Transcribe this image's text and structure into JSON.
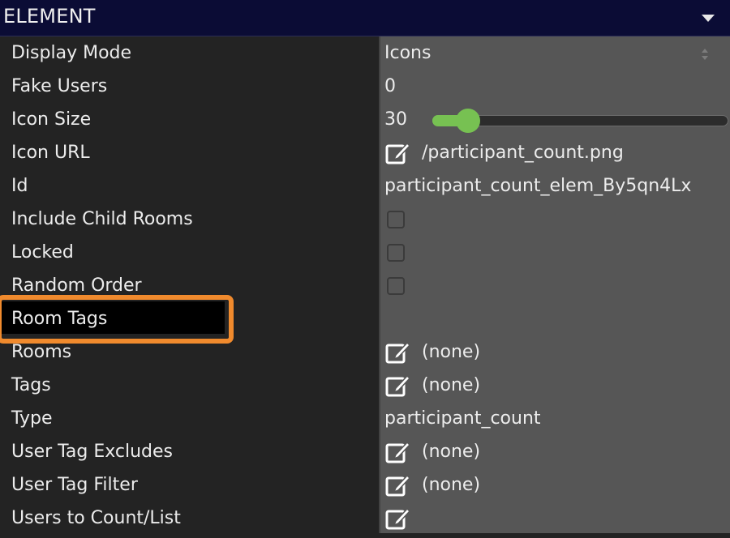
{
  "header": {
    "title": "ELEMENT",
    "collapse_icon": "caret-down-icon"
  },
  "properties": [
    {
      "label": "Display Mode",
      "value": "Icons",
      "kind": "select"
    },
    {
      "label": "Fake Users",
      "value": "0",
      "kind": "text"
    },
    {
      "label": "Icon Size",
      "value": "30",
      "kind": "slider",
      "slider_fraction": 0.08
    },
    {
      "label": "Icon URL",
      "value": "/participant_count.png",
      "kind": "edit"
    },
    {
      "label": "Id",
      "value": "participant_count_elem_By5qn4Lx",
      "kind": "text"
    },
    {
      "label": "Include Child Rooms",
      "value": "",
      "kind": "checkbox",
      "checked": false
    },
    {
      "label": "Locked",
      "value": "",
      "kind": "checkbox",
      "checked": false
    },
    {
      "label": "Random Order",
      "value": "",
      "kind": "checkbox",
      "checked": false
    },
    {
      "label": "Room Tags",
      "value": "",
      "kind": "empty"
    },
    {
      "label": "Rooms",
      "value": "(none)",
      "kind": "edit"
    },
    {
      "label": "Tags",
      "value": "(none)",
      "kind": "edit"
    },
    {
      "label": "Type",
      "value": "participant_count",
      "kind": "text"
    },
    {
      "label": "User Tag Excludes",
      "value": "(none)",
      "kind": "edit"
    },
    {
      "label": "User Tag Filter",
      "value": "(none)",
      "kind": "edit"
    },
    {
      "label": "Users to Count/List",
      "value": "",
      "kind": "edit"
    }
  ],
  "highlight_color": "#f08a2d",
  "slider_color": "#77c152"
}
